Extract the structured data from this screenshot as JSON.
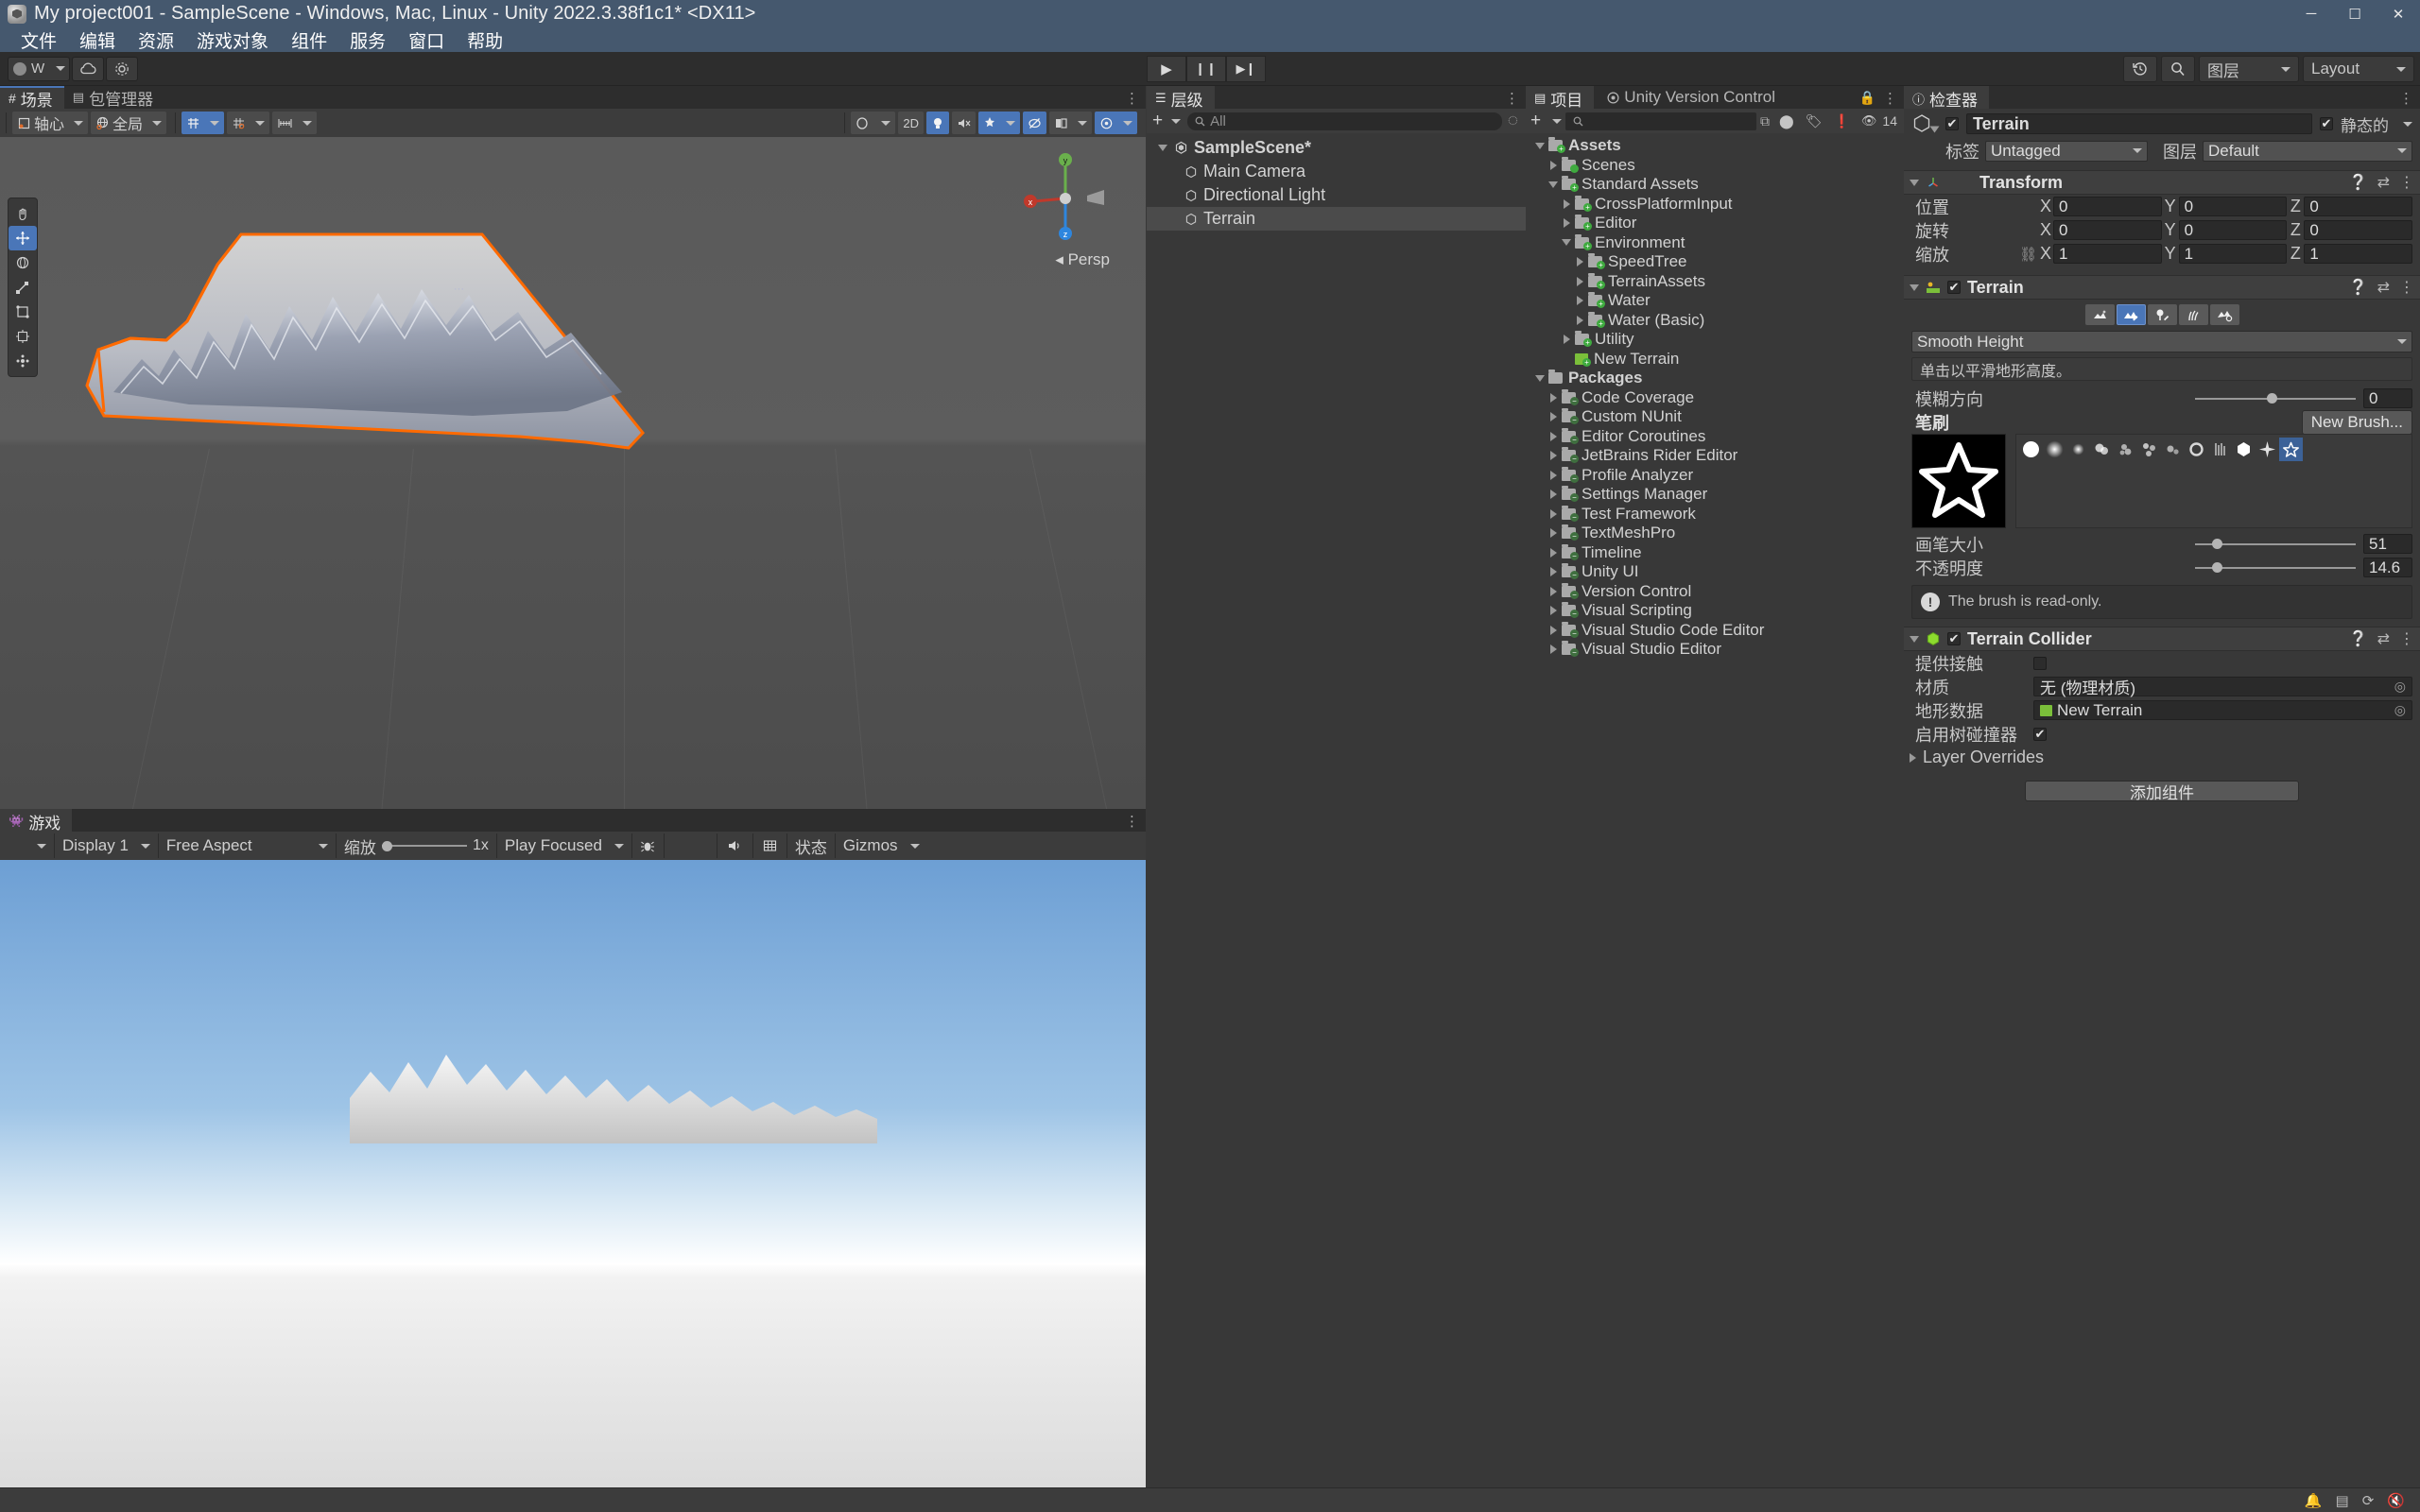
{
  "window": {
    "title": "My project001 - SampleScene - Windows, Mac, Linux - Unity 2022.3.38f1c1* <DX11>",
    "minimize": "─",
    "maximize": "☐",
    "close": "✕"
  },
  "menubar": {
    "items": [
      "文件",
      "编辑",
      "资源",
      "游戏对象",
      "组件",
      "服务",
      "窗口",
      "帮助"
    ]
  },
  "main_toolbar": {
    "left_buttons": [
      "account-icon",
      "cloud-icon",
      "settings-icon"
    ],
    "account_label": "W",
    "play": "▶",
    "pause": "❙❙",
    "step": "▶❙",
    "undo_history": "history-icon",
    "search": "search-icon",
    "layers_label": "图层",
    "layout_label": "Layout"
  },
  "scene_panel": {
    "tabs": [
      {
        "label": "场景",
        "icon": "scene-icon",
        "active": true
      },
      {
        "label": "包管理器",
        "icon": "package-icon",
        "active": false
      }
    ],
    "toolbar": {
      "pivot_label": "轴心",
      "space_label": "全局",
      "grid_snap": "grid-snap-icon",
      "snap_increment": "snap-increment-icon",
      "ruler": "ruler-icon",
      "view_options": "view-options-icon",
      "two_d": "2D",
      "lighting": "lighting-icon",
      "audio": "audio-mute-icon",
      "fx": "fx-icon",
      "hidden_objects": "hidden-objects-icon",
      "camera_settings": "camera-icon",
      "gizmos": "gizmos-icon"
    },
    "gizmo": {
      "x": "x",
      "y": "y",
      "z": "z",
      "persp": "◂ Persp"
    },
    "tools": [
      "hand-tool",
      "move-tool",
      "rotate-tool",
      "scale-tool",
      "rect-tool",
      "transform-tool",
      "custom-tool"
    ],
    "selection_outline_color": "#ff6a00"
  },
  "game_panel": {
    "tab": {
      "label": "游戏",
      "icon": "game-icon"
    },
    "display": "Display 1",
    "aspect": "Free Aspect",
    "scale_label": "缩放",
    "scale_value": "1x",
    "play_mode": "Play Focused",
    "mute_icon": "audio-icon",
    "stats_label": "状态",
    "gizmos_label": "Gizmos",
    "debug_icon": "bug-icon",
    "grid_icon": "grid-icon"
  },
  "hierarchy": {
    "tab": {
      "label": "层级",
      "icon": "hierarchy-icon"
    },
    "add_label": "+",
    "search_placeholder": "All",
    "items": [
      {
        "label": "SampleScene*",
        "depth": 0,
        "icon": "unity-scene-icon",
        "expanded": true,
        "selected": false,
        "bold": true
      },
      {
        "label": "Main Camera",
        "depth": 1,
        "icon": "gameobject-icon",
        "selected": false
      },
      {
        "label": "Directional Light",
        "depth": 1,
        "icon": "gameobject-icon",
        "selected": false
      },
      {
        "label": "Terrain",
        "depth": 1,
        "icon": "gameobject-icon",
        "selected": true
      }
    ]
  },
  "project": {
    "tabs": [
      {
        "label": "项目",
        "icon": "project-icon",
        "active": true
      },
      {
        "label": "Unity Version Control",
        "icon": "uvc-icon",
        "active": false
      }
    ],
    "add_label": "+",
    "search_placeholder": "",
    "eye_count": "14",
    "items": [
      {
        "label": "Assets",
        "depth": 0,
        "expanded": true,
        "bold": true,
        "kind": "folder-plus"
      },
      {
        "label": "Scenes",
        "depth": 1,
        "expanded": false,
        "kind": "folder-scene"
      },
      {
        "label": "Standard Assets",
        "depth": 1,
        "expanded": true,
        "kind": "folder-plus"
      },
      {
        "label": "CrossPlatformInput",
        "depth": 2,
        "expanded": false,
        "kind": "folder-plus"
      },
      {
        "label": "Editor",
        "depth": 2,
        "expanded": false,
        "kind": "folder-plus"
      },
      {
        "label": "Environment",
        "depth": 2,
        "expanded": true,
        "kind": "folder-plus"
      },
      {
        "label": "SpeedTree",
        "depth": 3,
        "expanded": false,
        "kind": "folder-plus"
      },
      {
        "label": "TerrainAssets",
        "depth": 3,
        "expanded": false,
        "kind": "folder-plus"
      },
      {
        "label": "Water",
        "depth": 3,
        "expanded": false,
        "kind": "folder-plus"
      },
      {
        "label": "Water (Basic)",
        "depth": 3,
        "expanded": false,
        "kind": "folder-plus"
      },
      {
        "label": "Utility",
        "depth": 2,
        "expanded": false,
        "kind": "folder-plus"
      },
      {
        "label": "New Terrain",
        "depth": 2,
        "expanded": null,
        "kind": "terrain-asset"
      },
      {
        "label": "Packages",
        "depth": 0,
        "expanded": true,
        "bold": true,
        "kind": "folder-plain"
      },
      {
        "label": "Code Coverage",
        "depth": 1,
        "expanded": false,
        "kind": "folder-minus"
      },
      {
        "label": "Custom NUnit",
        "depth": 1,
        "expanded": false,
        "kind": "folder-minus"
      },
      {
        "label": "Editor Coroutines",
        "depth": 1,
        "expanded": false,
        "kind": "folder-minus"
      },
      {
        "label": "JetBrains Rider Editor",
        "depth": 1,
        "expanded": false,
        "kind": "folder-minus"
      },
      {
        "label": "Profile Analyzer",
        "depth": 1,
        "expanded": false,
        "kind": "folder-minus"
      },
      {
        "label": "Settings Manager",
        "depth": 1,
        "expanded": false,
        "kind": "folder-minus"
      },
      {
        "label": "Test Framework",
        "depth": 1,
        "expanded": false,
        "kind": "folder-minus"
      },
      {
        "label": "TextMeshPro",
        "depth": 1,
        "expanded": false,
        "kind": "folder-minus"
      },
      {
        "label": "Timeline",
        "depth": 1,
        "expanded": false,
        "kind": "folder-minus"
      },
      {
        "label": "Unity UI",
        "depth": 1,
        "expanded": false,
        "kind": "folder-minus"
      },
      {
        "label": "Version Control",
        "depth": 1,
        "expanded": false,
        "kind": "folder-minus"
      },
      {
        "label": "Visual Scripting",
        "depth": 1,
        "expanded": false,
        "kind": "folder-minus"
      },
      {
        "label": "Visual Studio Code Editor",
        "depth": 1,
        "expanded": false,
        "kind": "folder-minus"
      },
      {
        "label": "Visual Studio Editor",
        "depth": 1,
        "expanded": false,
        "kind": "folder-minus"
      }
    ]
  },
  "inspector": {
    "tab": {
      "label": "检查器",
      "icon": "inspector-icon"
    },
    "object": {
      "name": "Terrain",
      "enabled": true,
      "static_label": "静态的",
      "static_checked": true,
      "tag_label": "标签",
      "tag_value": "Untagged",
      "layer_label": "图层",
      "layer_value": "Default"
    },
    "transform": {
      "title": "Transform",
      "rows": [
        {
          "label": "位置",
          "x": "0",
          "y": "0",
          "z": "0"
        },
        {
          "label": "旋转",
          "x": "0",
          "y": "0",
          "z": "0"
        },
        {
          "label": "缩放",
          "x": "1",
          "y": "1",
          "z": "1",
          "link_icon": "link-broken-icon"
        }
      ]
    },
    "terrain": {
      "title": "Terrain",
      "tools": [
        {
          "name": "create-neighbor-terrains-icon",
          "active": false
        },
        {
          "name": "paint-terrain-icon",
          "active": true
        },
        {
          "name": "paint-trees-icon",
          "active": false
        },
        {
          "name": "paint-details-icon",
          "active": false
        },
        {
          "name": "terrain-settings-icon",
          "active": false
        }
      ],
      "tool_mode": "Smooth Height",
      "description": "单击以平滑地形高度。",
      "blur_label": "模糊方向",
      "blur_value": "0",
      "blur_slider_pct": 48,
      "brushes_label": "笔刷",
      "new_brush_label": "New Brush...",
      "brush_preview": "star-outline-brush",
      "brush_icons": [
        "circle-hard",
        "circle-soft",
        "circle-small",
        "cloud-1",
        "cloud-2",
        "cloud-3",
        "cloud-4",
        "ring-splat",
        "streak",
        "hexagon",
        "sparkle-star",
        "star-outline"
      ],
      "selected_brush_index": 11,
      "size_label": "画笔大小",
      "size_value": "51",
      "size_slider_pct": 14,
      "opacity_label": "不透明度",
      "opacity_value": "14.6",
      "opacity_slider_pct": 14,
      "warning": "The brush is read-only."
    },
    "terrain_collider": {
      "title": "Terrain Collider",
      "rows": [
        {
          "label": "提供接触",
          "type": "checkbox",
          "checked": false
        },
        {
          "label": "材质",
          "type": "object",
          "value": "无 (物理材质)"
        },
        {
          "label": "地形数据",
          "type": "object",
          "value": "New Terrain",
          "icon": "terrain-asset-icon"
        },
        {
          "label": "启用树碰撞器",
          "type": "checkbox",
          "checked": true
        }
      ],
      "layer_overrides": "Layer Overrides"
    },
    "add_component_label": "添加组件"
  },
  "statusbar": {
    "icons": [
      "bell-icon",
      "layers-icon",
      "sync-icon",
      "mute-icon"
    ]
  },
  "colors": {
    "accent_blue": "#4a76b8",
    "panel_bg": "#383838",
    "toolbar_bg": "#2d2d2d",
    "titlebar_bg": "#45586e",
    "selection_orange": "#ff6a00"
  }
}
